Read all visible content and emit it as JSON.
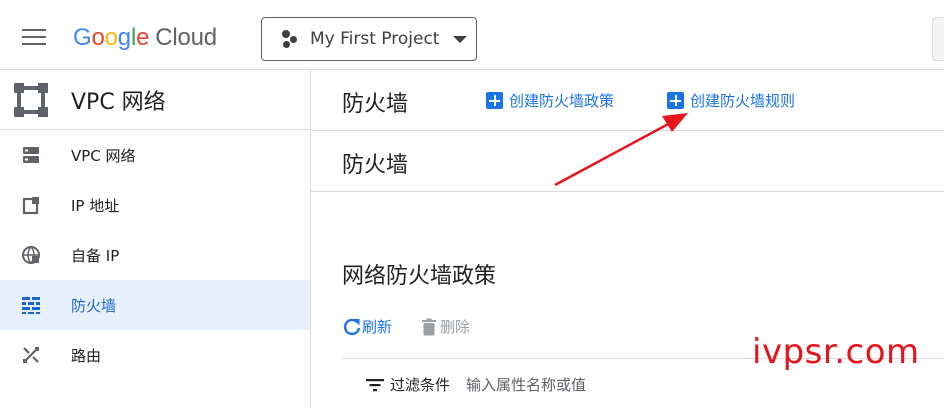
{
  "topbar": {
    "logo_google": [
      "G",
      "o",
      "o",
      "g",
      "l",
      "e"
    ],
    "logo_cloud": "Cloud",
    "project_name": "My First Project"
  },
  "sidebar": {
    "product_title": "VPC 网络",
    "items": [
      {
        "label": "VPC 网络",
        "icon": "vpc-network-icon"
      },
      {
        "label": "IP 地址",
        "icon": "ip-address-icon"
      },
      {
        "label": "自备 IP",
        "icon": "globe-icon"
      },
      {
        "label": "防火墙",
        "icon": "firewall-icon",
        "active": true
      },
      {
        "label": "路由",
        "icon": "routes-icon"
      }
    ]
  },
  "main": {
    "page_title": "防火墙",
    "actions": {
      "create_policy": "创建防火墙政策",
      "create_rule": "创建防火墙规则"
    },
    "sub_title": "防火墙",
    "section_title": "网络防火墙政策",
    "toolbar": {
      "refresh": "刷新",
      "delete": "删除"
    },
    "filter": {
      "label": "过滤条件",
      "placeholder": "输入属性名称或值"
    }
  },
  "watermark": "ivpsr.com",
  "colors": {
    "accent": "#1a73e8",
    "active_bg": "#e8f0fe",
    "annotation": "#e8141b"
  }
}
